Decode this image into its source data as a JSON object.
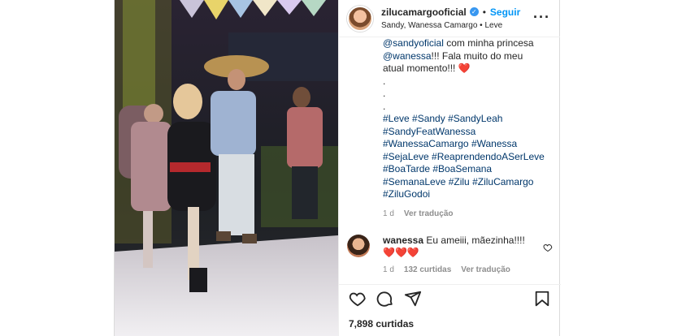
{
  "post": {
    "author": {
      "username": "zilucamargooficial",
      "verified_icon": "verified-badge-icon",
      "follow_label": "Seguir",
      "separator": "•",
      "location": "Sandy, Wanessa Camargo • Leve"
    },
    "more_icon": "more-options-icon",
    "caption": {
      "mention_1": "@sandyoficial",
      "text_1": " com minha princesa",
      "mention_2": "@wanessa",
      "text_2": "!!! Fala muito do meu",
      "text_3": "atual momento!!! ❤️",
      "dots": [
        ".",
        ".",
        "."
      ],
      "hashtags_lines": [
        "#Leve #Sandy #SandyLeah",
        "#SandyFeatWanessa",
        "#WanessaCamargo #Wanessa",
        "#SejaLeve #ReaprendendoASerLeve",
        "#BoaTarde #BoaSemana",
        "#SemanaLeve #Zilu #ZiluCamargo",
        "#ZiluGodoi"
      ],
      "time": "1 d",
      "translate": "Ver tradução"
    },
    "comment": {
      "username": "wanessa",
      "text_1": "Eu ameiii, mãezinha!!!!",
      "text_2": "❤️❤️❤️",
      "time": "1 d",
      "likes": "132 curtidas",
      "translate": "Ver tradução"
    },
    "actions": {
      "like_icon": "heart-icon",
      "comment_icon": "comment-icon",
      "share_icon": "share-icon",
      "save_icon": "bookmark-icon"
    },
    "likes_count": "7,898 curtidas"
  },
  "colors": {
    "link_blue": "#0095f6",
    "mention_navy": "#00376b",
    "meta_gray": "#8e8e8e",
    "border": "#dbdbdb"
  }
}
